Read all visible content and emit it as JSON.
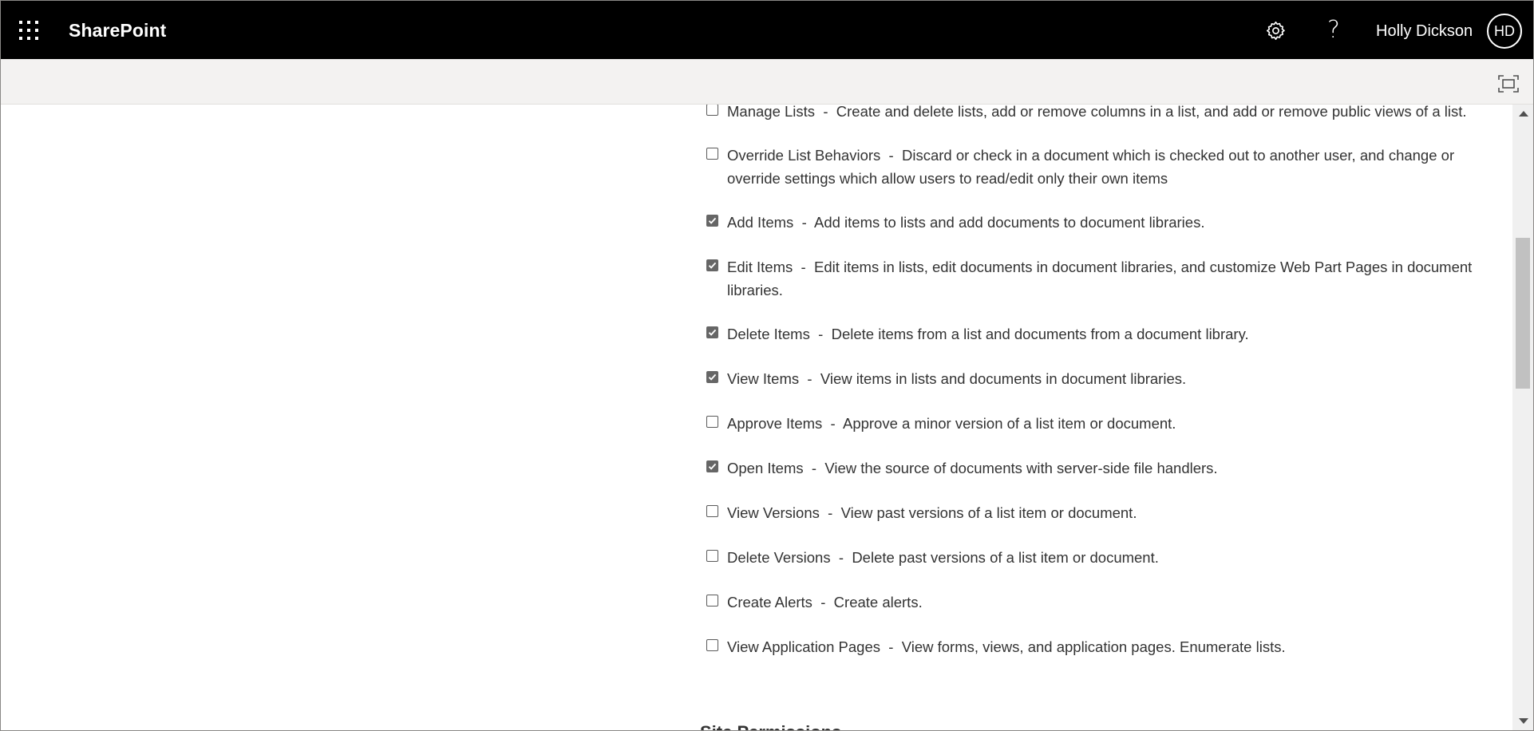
{
  "suite_bar": {
    "app_name": "SharePoint",
    "user_name": "Holly Dickson",
    "user_initials": "HD",
    "help_glyph": "?",
    "icons": [
      "app-launcher-icon",
      "settings-gear-icon",
      "help-icon"
    ]
  },
  "command_bar": {
    "icons": [
      "focus-mode-icon"
    ]
  },
  "permissions": [
    {
      "name": "Manage Lists",
      "separator": "  -  ",
      "description": "Create and delete lists, add or remove columns in a list, and add or remove public views of a list.",
      "checked": false
    },
    {
      "name": "Override List Behaviors",
      "separator": "  -  ",
      "description": "Discard or check in a document which is checked out to another user, and change or override settings which allow users to read/edit only their own items",
      "checked": false
    },
    {
      "name": "Add Items",
      "separator": "  -  ",
      "description": "Add items to lists and add documents to document libraries.",
      "checked": true
    },
    {
      "name": "Edit Items",
      "separator": "  -  ",
      "description": "Edit items in lists, edit documents in document libraries, and customize Web Part Pages in document libraries.",
      "checked": true
    },
    {
      "name": "Delete Items",
      "separator": "  -  ",
      "description": "Delete items from a list and documents from a document library.",
      "checked": true
    },
    {
      "name": "View Items",
      "separator": "  -  ",
      "description": "View items in lists and documents in document libraries.",
      "checked": true
    },
    {
      "name": "Approve Items",
      "separator": "  -  ",
      "description": "Approve a minor version of a list item or document.",
      "checked": false
    },
    {
      "name": "Open Items",
      "separator": "  -  ",
      "description": "View the source of documents with server-side file handlers.",
      "checked": true
    },
    {
      "name": "View Versions",
      "separator": "  -  ",
      "description": "View past versions of a list item or document.",
      "checked": false
    },
    {
      "name": "Delete Versions",
      "separator": "  -  ",
      "description": "Delete past versions of a list item or document.",
      "checked": false
    },
    {
      "name": "Create Alerts",
      "separator": "  -  ",
      "description": "Create alerts.",
      "checked": false
    },
    {
      "name": "View Application Pages",
      "separator": "  -  ",
      "description": "View forms, views, and application pages. Enumerate lists.",
      "checked": false
    }
  ],
  "next_section": {
    "heading": "Site Permissions"
  },
  "scrollbar": {
    "position_fraction": 0.25
  },
  "colors": {
    "suite_bar_bg": "#000000",
    "command_bar_bg": "#f3f2f1",
    "checkbox_checked": "#666666",
    "text": "#333333"
  }
}
